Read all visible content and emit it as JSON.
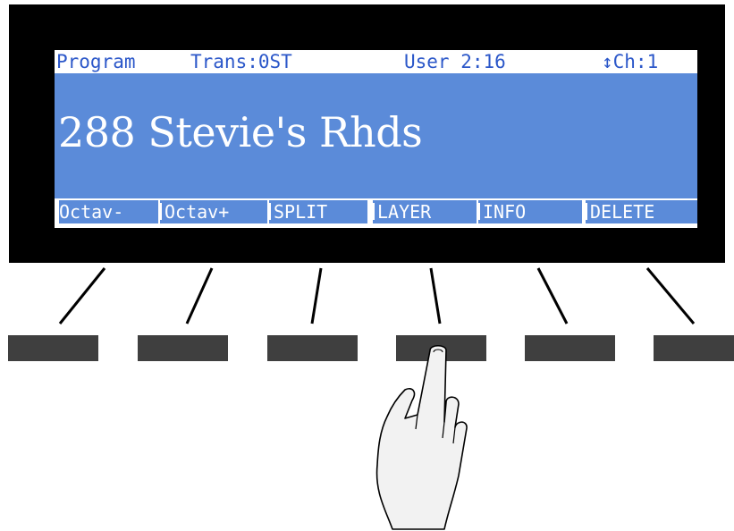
{
  "status": {
    "mode": "Program",
    "transpose": "Trans:0ST",
    "bank": "User 2:16",
    "channel": "↕Ch:1"
  },
  "program": {
    "name": "288 Stevie's Rhds"
  },
  "soft_buttons": [
    {
      "label": "Octav-"
    },
    {
      "label": "Octav+"
    },
    {
      "label": "SPLIT"
    },
    {
      "label": "LAYER"
    },
    {
      "label": "INFO"
    },
    {
      "label": "DELETE"
    }
  ],
  "icons": {
    "pressed_button": "hand-pointer-icon"
  },
  "colors": {
    "bezel": "#000000",
    "lcd_background": "#ffffff",
    "lcd_highlight": "#5b8bd9",
    "lcd_text_blue": "#2b57c9",
    "button": "#3f3f3f"
  }
}
